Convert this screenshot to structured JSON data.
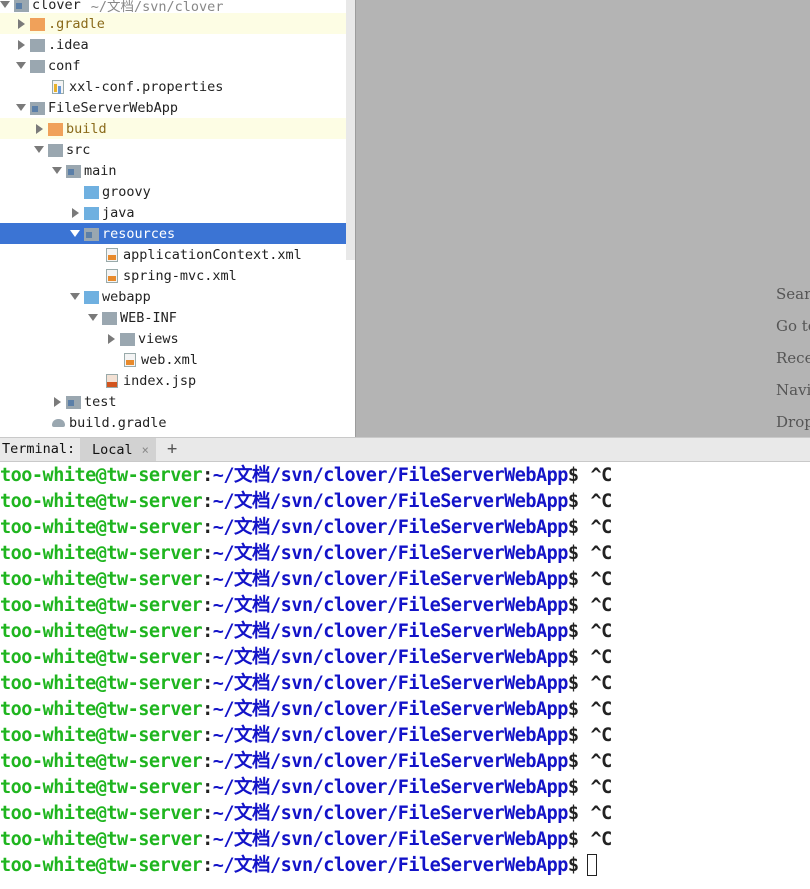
{
  "project_tree": {
    "root": {
      "label": "clover",
      "path": "~/文档/svn/clover"
    },
    "rows": [
      {
        "label": ".gradle",
        "kind": "folder-orange"
      },
      {
        "label": ".idea",
        "kind": "folder"
      },
      {
        "label": "conf",
        "kind": "folder"
      },
      {
        "label": "xxl-conf.properties",
        "kind": "file-properties"
      },
      {
        "label": "FileServerWebApp",
        "kind": "module"
      },
      {
        "label": "build",
        "kind": "folder-orange"
      },
      {
        "label": "src",
        "kind": "folder"
      },
      {
        "label": "main",
        "kind": "folder-module"
      },
      {
        "label": "groovy",
        "kind": "folder-source"
      },
      {
        "label": "java",
        "kind": "folder-source"
      },
      {
        "label": "resources",
        "kind": "folder-resources",
        "selected": true
      },
      {
        "label": "applicationContext.xml",
        "kind": "file-xml"
      },
      {
        "label": "spring-mvc.xml",
        "kind": "file-xml"
      },
      {
        "label": "webapp",
        "kind": "folder-web"
      },
      {
        "label": "WEB-INF",
        "kind": "folder"
      },
      {
        "label": "views",
        "kind": "folder"
      },
      {
        "label": "web.xml",
        "kind": "file-xml"
      },
      {
        "label": "index.jsp",
        "kind": "file-jsp"
      },
      {
        "label": "test",
        "kind": "folder"
      },
      {
        "label": "build.gradle",
        "kind": "file-gradle"
      }
    ]
  },
  "editor_hints": [
    "Searc",
    "Go to",
    "Recen",
    "Navig",
    "Drop"
  ],
  "terminal_tabs": {
    "title": "Terminal:",
    "tabs": [
      {
        "label": "Local",
        "close": "×"
      }
    ],
    "add": "+"
  },
  "terminal": {
    "user": "too-white@tw-server",
    "separator": ":",
    "path": "~/文档/svn/clover/FileServerWebApp",
    "dollar": "$",
    "command": "^C",
    "interrupted_count": 15
  },
  "colors": {
    "selection": "#3b74d4",
    "terminal_user": "#1fb51f",
    "terminal_path": "#1313c8",
    "editor_bg": "#b4b4b4"
  }
}
